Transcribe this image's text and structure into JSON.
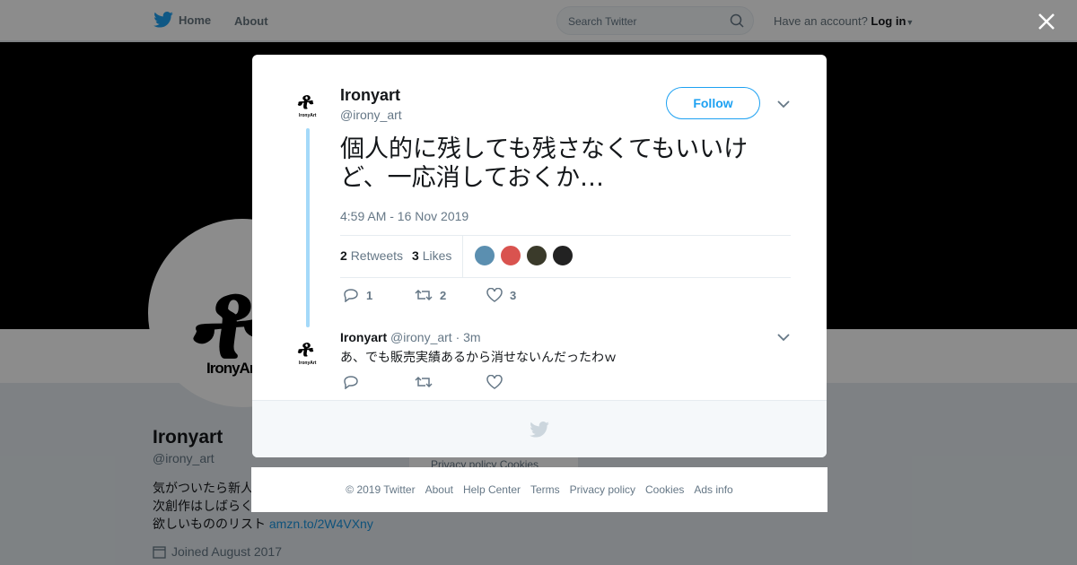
{
  "nav": {
    "home": "Home",
    "about": "About",
    "search_placeholder": "Search Twitter",
    "have_account": "Have an account?",
    "login": "Log in"
  },
  "profile": {
    "name": "Ironyart",
    "handle": "@irony_art",
    "bio_lines": [
      "気がついたら新人",
      "次創作はしばらく",
      "欲しいもののリスト"
    ],
    "bio_link": "amzn.to/2W4VXny",
    "joined": "Joined August 2017",
    "avatar_brand": "IronyArt"
  },
  "bg_footer": {
    "privacy": "Privacy policy",
    "cookies": "Cookies"
  },
  "tweet": {
    "name": "Ironyart",
    "handle": "@irony_art",
    "follow": "Follow",
    "text": "個人的に残しても残さなくてもいいけど、一応消しておくか…",
    "time": "4:59 AM - 16 Nov 2019",
    "retweets_count": "2",
    "retweets_label": "Retweets",
    "likes_count": "3",
    "likes_label": "Likes",
    "reply_count": "1",
    "retweet_count": "2",
    "like_count": "3",
    "liker_colors": [
      "#5b8fb0",
      "#d9534f",
      "#3a3a2a",
      "#222222"
    ]
  },
  "reply": {
    "name": "Ironyart",
    "handle": "@irony_art",
    "age": "· 3m",
    "text": "あ、でも販売実績あるから消せないんだったわｗ"
  },
  "footer": {
    "copyright": "© 2019 Twitter",
    "about": "About",
    "help": "Help Center",
    "terms": "Terms",
    "privacy": "Privacy policy",
    "cookies": "Cookies",
    "ads": "Ads info"
  },
  "colors": {
    "accent": "#1da1f2",
    "thread": "#a4d9f9",
    "muted": "#657786"
  }
}
